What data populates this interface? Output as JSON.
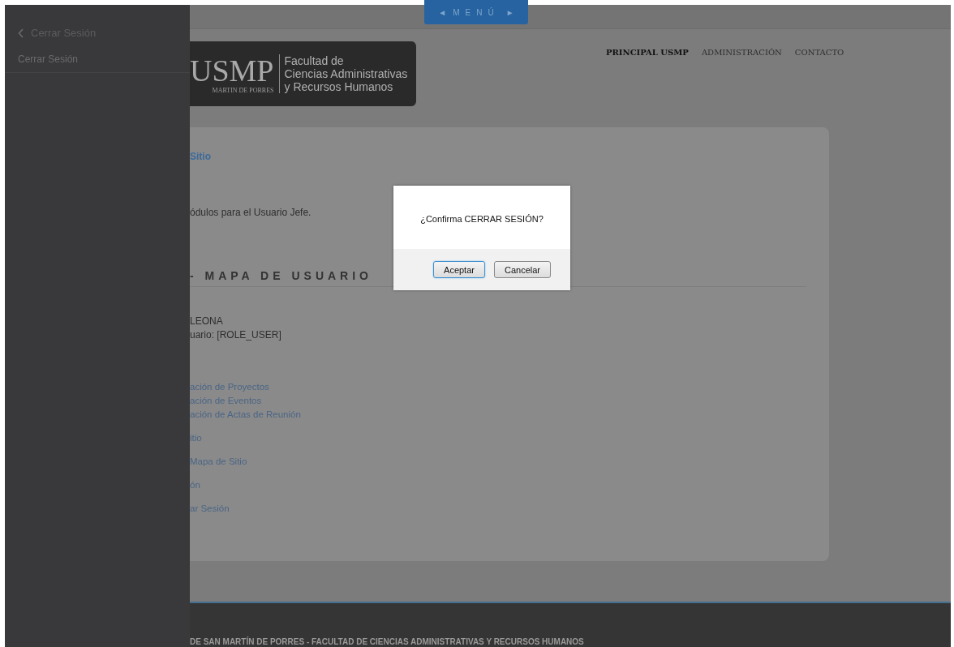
{
  "drawer": {
    "back": {
      "label": "Cerrar Sesión"
    },
    "items": [
      {
        "label": "Cerrar Sesión"
      }
    ]
  },
  "menu_tab": {
    "left": "◄",
    "label": "MENÚ",
    "right": "►"
  },
  "logo": {
    "mark": "USMP",
    "subtitle": "MARTIN DE PORRES",
    "lines": [
      "Facultad de",
      "Ciencias Administrativas",
      "y Recursos Humanos"
    ]
  },
  "nav": [
    {
      "label": "PRINCIPAL USMP",
      "selected": true
    },
    {
      "label": "ADMINISTRACIÓN",
      "selected": false
    },
    {
      "label": "CONTACTO",
      "selected": false
    }
  ],
  "content": {
    "title": "Sitio",
    "intro": "ódulos para el Usuario Jefe.",
    "section_heading": "- MAPA DE USUARIO",
    "user_lines": [
      "LEONA",
      "uario: [ROLE_USER]"
    ],
    "link_groups": [
      {
        "links": [
          "ación de Proyectos",
          "ación de Eventos",
          "ación de Actas de Reunión"
        ]
      },
      {
        "links": [
          "itio"
        ]
      },
      {
        "links": [
          "Mapa de Sitio"
        ]
      },
      {
        "links": [
          "ón"
        ]
      },
      {
        "links": [
          "ar Sesión"
        ]
      }
    ]
  },
  "dialog": {
    "message": "¿Confirma CERRAR SESIÓN?",
    "buttons": [
      {
        "label": "Aceptar",
        "selected": true
      },
      {
        "label": "Cancelar",
        "selected": false
      }
    ]
  },
  "footer": {
    "text": "DE SAN MARTÍN DE PORRES - FACULTAD DE CIENCIAS ADMINISTRATIVAS Y RECURSOS HUMANOS"
  }
}
